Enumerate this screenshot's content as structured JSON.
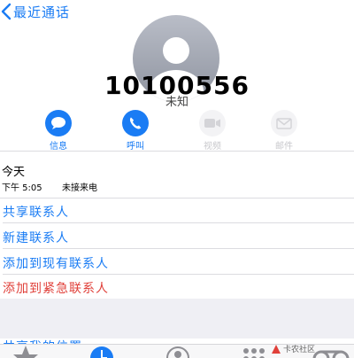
{
  "nav": {
    "back_label": "最近通话"
  },
  "contact": {
    "number": "10100556",
    "subtitle": "未知"
  },
  "actions": [
    {
      "label": "信息",
      "icon": "message-icon",
      "enabled": true
    },
    {
      "label": "呼叫",
      "icon": "phone-icon",
      "enabled": true
    },
    {
      "label": "视频",
      "icon": "video-icon",
      "enabled": false
    },
    {
      "label": "邮件",
      "icon": "mail-icon",
      "enabled": false
    }
  ],
  "recent": {
    "day": "今天",
    "time": "下午 5:05",
    "status": "未接来电"
  },
  "menu": [
    {
      "label": "共享联系人"
    },
    {
      "label": "新建联系人"
    },
    {
      "label": "添加到现有联系人"
    },
    {
      "label": "添加到紧急联系人"
    }
  ],
  "cut_off_item": "共享我的位置",
  "watermark": "卡农社区",
  "colors": {
    "accent": "#1a7cf4",
    "danger": "#e0403a",
    "disabled": "#c8c8cc"
  }
}
